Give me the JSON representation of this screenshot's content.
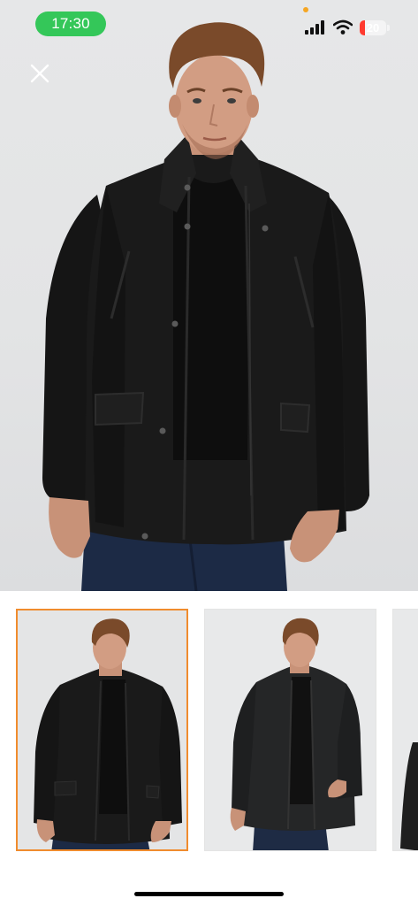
{
  "status_bar": {
    "time": "17:30",
    "battery_level": "20",
    "battery_fraction": 0.2,
    "time_pill_color": "#34c759",
    "battery_color": "#ff3b30",
    "icons": [
      "signal-icon",
      "wifi-icon",
      "battery-icon"
    ]
  },
  "viewer": {
    "close_icon": "close-icon",
    "main_image": "product-photo-black-jacket-front",
    "thumbnails": [
      {
        "id": "thumb-1",
        "image": "black-jacket-front",
        "selected": true
      },
      {
        "id": "thumb-2",
        "image": "black-jacket-three-quarter",
        "selected": false
      },
      {
        "id": "thumb-3",
        "image": "black-jacket-side",
        "selected": false
      }
    ],
    "selected_border_color": "#f08c2e"
  }
}
